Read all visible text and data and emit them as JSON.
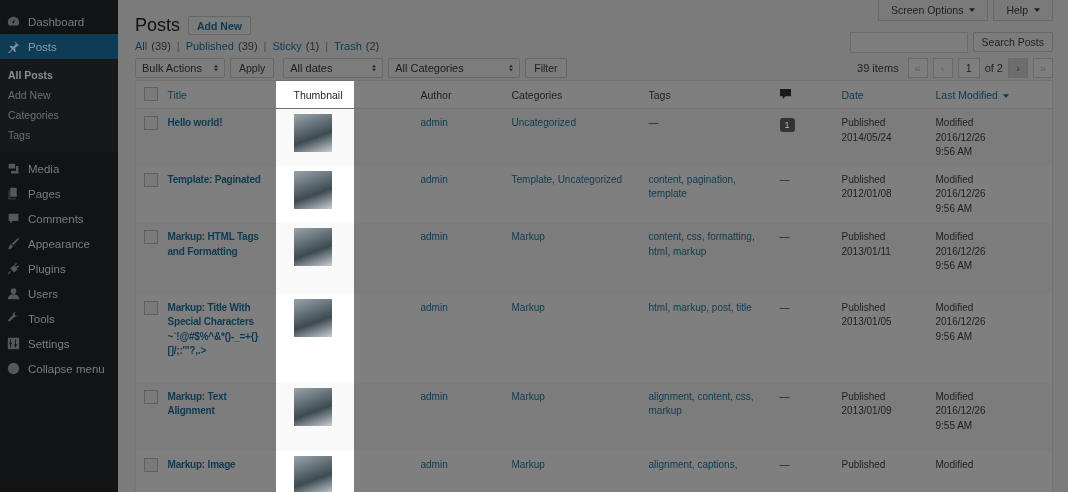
{
  "sidebar": {
    "items": [
      {
        "label": "Dashboard",
        "selected": false
      },
      {
        "label": "Posts",
        "selected": true,
        "children": [
          {
            "label": "All Posts",
            "selected": true
          },
          {
            "label": "Add New",
            "selected": false
          },
          {
            "label": "Categories",
            "selected": false
          },
          {
            "label": "Tags",
            "selected": false
          }
        ]
      },
      {
        "label": "Media",
        "selected": false
      },
      {
        "label": "Pages",
        "selected": false
      },
      {
        "label": "Comments",
        "selected": false
      },
      {
        "label": "Appearance",
        "selected": false
      },
      {
        "label": "Plugins",
        "selected": false
      },
      {
        "label": "Users",
        "selected": false
      },
      {
        "label": "Tools",
        "selected": false
      },
      {
        "label": "Settings",
        "selected": false
      },
      {
        "label": "Collapse menu",
        "selected": false
      }
    ]
  },
  "screen_tabs": [
    "Screen Options",
    "Help"
  ],
  "title": "Posts",
  "add_new": "Add New",
  "views": [
    {
      "label": "All",
      "count": "(39)"
    },
    {
      "separator": "|",
      "label": "Published",
      "count": "(39)"
    },
    {
      "separator": "|",
      "label": "Sticky",
      "count": "(1)"
    },
    {
      "separator": "|",
      "label": "Trash",
      "count": "(2)"
    }
  ],
  "search": {
    "button": "Search Posts"
  },
  "bulk_actions": {
    "value": "Bulk Actions",
    "button": "Apply"
  },
  "filters": [
    "All dates",
    "All Categories"
  ],
  "filter_button": "Filter",
  "pagination": {
    "items": "39 items",
    "before": [
      {
        "label": "«",
        "disabled": true
      },
      {
        "label": "‹",
        "disabled": true
      }
    ],
    "page": "1",
    "of": "of 2",
    "after": [
      {
        "label": "›",
        "disabled": false
      },
      {
        "label": "»",
        "disabled": true
      }
    ]
  },
  "table": {
    "select_all_checked": false,
    "columns": [
      {
        "label": "Title",
        "kind": "link",
        "sorted": false
      },
      {
        "label": "Thumbnail",
        "kind": "text"
      },
      {
        "label": "Author",
        "kind": "text"
      },
      {
        "label": "Categories",
        "kind": "text"
      },
      {
        "label": "Tags",
        "kind": "text"
      },
      {
        "kind": "icon"
      },
      {
        "label": "Date",
        "kind": "link",
        "sorted": false
      },
      {
        "label": "Last Modified",
        "kind": "link",
        "sorted": true
      }
    ],
    "rows": [
      {
        "checked": false,
        "title": "Hello world!",
        "author": "admin",
        "categories": "Uncategorized",
        "tags": {
          "text": "—",
          "linked": false
        },
        "comments": {
          "count": "1",
          "kind": "bubble"
        },
        "date": [
          "Published",
          "2014/05/24"
        ],
        "modified": [
          "Modified",
          "2016/12/26",
          "9:56 AM"
        ]
      },
      {
        "checked": false,
        "title": "Template: Paginated",
        "author": "admin",
        "categories": "Template, Uncategorized",
        "tags": {
          "text": "content, pagination, template",
          "linked": true
        },
        "comments": {
          "count": "—",
          "kind": "none"
        },
        "date": [
          "Published",
          "2012/01/08"
        ],
        "modified": [
          "Modified",
          "2016/12/26",
          "9:56 AM"
        ]
      },
      {
        "checked": false,
        "title": "Markup: HTML Tags and Formatting",
        "author": "admin",
        "categories": "Markup",
        "tags": {
          "text": "content, css, formatting, html, markup",
          "linked": true
        },
        "comments": {
          "count": "—",
          "kind": "none"
        },
        "date": [
          "Published",
          "2013/01/11"
        ],
        "modified": [
          "Modified",
          "2016/12/26",
          "9:56 AM"
        ]
      },
      {
        "checked": false,
        "title": "Markup: Title With Special Characters ~`!@#$%^&*()-_=+{} []/;:'\"?,.>",
        "author": "admin",
        "categories": "Markup",
        "tags": {
          "text": "html, markup, post, title",
          "linked": true
        },
        "comments": {
          "count": "—",
          "kind": "none"
        },
        "date": [
          "Published",
          "2013/01/05"
        ],
        "modified": [
          "Modified",
          "2016/12/26",
          "9:56 AM"
        ]
      },
      {
        "checked": false,
        "title": "Markup: Text Alignment",
        "author": "admin",
        "categories": "Markup",
        "tags": {
          "text": "alignment, content, css, markup",
          "linked": true
        },
        "comments": {
          "count": "—",
          "kind": "none"
        },
        "date": [
          "Published",
          "2013/01/09"
        ],
        "modified": [
          "Modified",
          "2016/12/26",
          "9:55 AM"
        ]
      },
      {
        "checked": false,
        "title": "Markup: Image",
        "author": "admin",
        "categories": "Markup",
        "tags": {
          "text": "alignment, captions,",
          "linked": true
        },
        "comments": {
          "count": "—",
          "kind": "none"
        },
        "date": [
          "Published"
        ],
        "modified": [
          "Modified"
        ]
      }
    ]
  }
}
